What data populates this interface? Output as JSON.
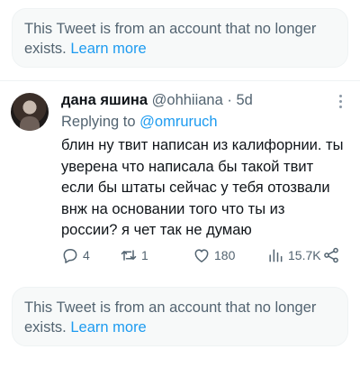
{
  "notice_top": {
    "text": "This Tweet is from an account that no longer exists.",
    "link": "Learn more"
  },
  "tweet": {
    "author_name": "дана яшина",
    "handle": "@ohhiiana",
    "separator": "·",
    "time": "5d",
    "replying_prefix": "Replying to",
    "replying_to": "@omruruch",
    "text_lines": [
      "блин ну твит написан из калифорнии. ты",
      "уверена что написала бы такой твит",
      "если бы штаты сейчас у тебя отозвали",
      "внж на основании того что ты из",
      "россии? я чет так не думаю"
    ],
    "actions": {
      "replies": "4",
      "retweets": "1",
      "likes": "180",
      "views": "15.7K"
    },
    "icons": [
      "reply-icon",
      "retweet-icon",
      "like-icon",
      "views-icon",
      "share-icon",
      "more-icon"
    ]
  },
  "notice_bottom": {
    "text": "This Tweet is from an account that no longer exists.",
    "link": "Learn more"
  },
  "colors": {
    "accent": "#1d9bf0",
    "secondary_text": "#536471",
    "notice_bg": "#f7f9f9"
  }
}
